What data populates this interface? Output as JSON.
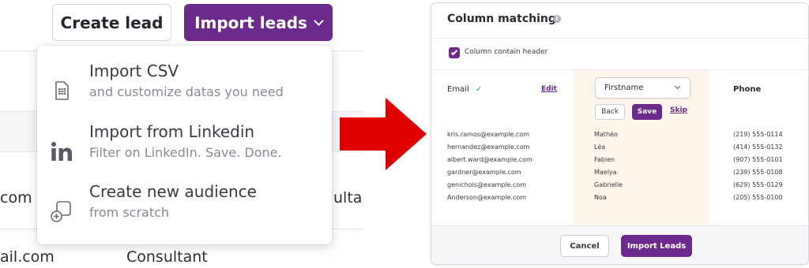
{
  "left_panel": {
    "create_lead_label": "Create lead",
    "import_leads_label": "Import leads",
    "background_text": {
      "row1_email_fragment": "com",
      "row1_role_fragment": "ultar",
      "row2_email_fragment": "ail.com",
      "row2_role": "Consultant"
    },
    "dropdown": {
      "items": [
        {
          "icon": "csv-file-icon",
          "title": "Import CSV",
          "subtitle": "and customize datas you need"
        },
        {
          "icon": "linkedin-icon",
          "title": "Import from Linkedin",
          "subtitle": "Filter on LinkedIn. Save. Done."
        },
        {
          "icon": "add-audience-icon",
          "title": "Create new audience",
          "subtitle": "from scratch"
        }
      ]
    }
  },
  "arrow": {
    "icon": "right-arrow-icon",
    "color": "#e00000"
  },
  "column_matching": {
    "title": "Column matching",
    "info_icon": "info-icon",
    "header_checkbox": {
      "label": "Column contain header",
      "checked": true
    },
    "email_column": {
      "label": "Email",
      "edit_label": "Edit",
      "matched": true
    },
    "firstname_column": {
      "select_value": "Firstname",
      "back_label": "Back",
      "save_label": "Save",
      "skip_label": "Skip"
    },
    "phone_column": {
      "label": "Phone"
    },
    "rows": [
      {
        "email": "kris.ramos@example.com",
        "firstname": "Mathéo",
        "phone": "(219) 555-0114"
      },
      {
        "email": "hernandez@example.com",
        "firstname": "Léa",
        "phone": "(414) 555-0132"
      },
      {
        "email": "albert.ward@example.com",
        "firstname": "Fabien",
        "phone": "(907) 555-0101"
      },
      {
        "email": "gardner@example.com",
        "firstname": "Maelya",
        "phone": "(239) 555-0108"
      },
      {
        "email": "genichols@example.com",
        "firstname": "Gabrielle",
        "phone": "(629) 555-0129"
      },
      {
        "email": "Anderson@example.com",
        "firstname": "Noa",
        "phone": "(205) 555-0100"
      }
    ],
    "footer": {
      "cancel_label": "Cancel",
      "import_label": "Import Leads"
    }
  },
  "colors": {
    "brand_purple": "#6b2a8c",
    "highlight_column": "#fdf5ec",
    "arrow_red": "#e00000"
  }
}
